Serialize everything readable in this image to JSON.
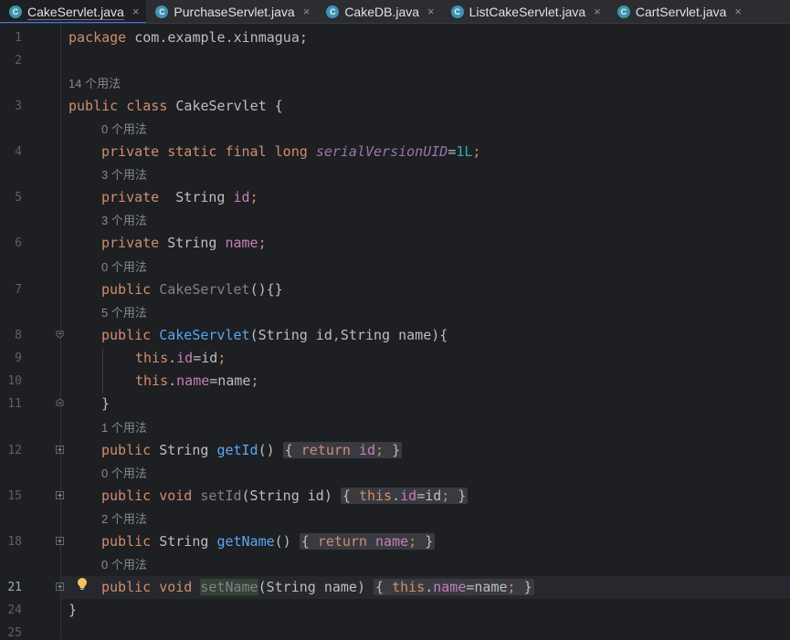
{
  "tabs": [
    {
      "label": "CakeServlet.java",
      "icon": "C",
      "active": true
    },
    {
      "label": "PurchaseServlet.java",
      "icon": "C",
      "active": false
    },
    {
      "label": "CakeDB.java",
      "icon": "C",
      "active": false
    },
    {
      "label": "ListCakeServlet.java",
      "icon": "C",
      "active": false
    },
    {
      "label": "CartServlet.java",
      "icon": "C",
      "active": false
    }
  ],
  "close_glyph": "×",
  "line_numbers": [
    "1",
    "2",
    "3",
    "4",
    "5",
    "6",
    "7",
    "8",
    "9",
    "10",
    "11",
    "12",
    "15",
    "18",
    "21",
    "24",
    "25"
  ],
  "current_line": "21",
  "hints": {
    "class_usages": "14 个用法",
    "serial_usages": "0 个用法",
    "id_usages": "3 个用法",
    "name_usages": "3 个用法",
    "ctor0_usages": "0 个用法",
    "ctor2_usages": "5 个用法",
    "getid_usages": "1 个用法",
    "setid_usages": "0 个用法",
    "getname_usages": "2 个用法",
    "setname_usages": "0 个用法"
  },
  "code": {
    "l1_kw": "package",
    "l1_rest": " com.example.xinmagua;",
    "l3_kw": "public class",
    "l3_rest": " CakeServlet {",
    "l4_kw": "private static final long",
    "l4_field": "serialVersionUID",
    "l4_eq": "=",
    "l4_num": "1L",
    "l4_semi": ";",
    "l5_kw": "private",
    "l5_type": "  String ",
    "l5_field": "id",
    "l5_semi": ";",
    "l6_kw": "private",
    "l6_type": " String ",
    "l6_field": "name",
    "l6_semi": ";",
    "l7_kw": "public",
    "l7_name": "CakeServlet",
    "l7_rest": "(){}",
    "l8_kw": "public",
    "l8_name": "CakeServlet",
    "l8_p1": "(String id",
    "l8_comma": ",",
    "l8_p2": "String name){",
    "l9_this": "this",
    "l9_dot": ".",
    "l9_field": "id",
    "l9_rest": "=id",
    "l9_semi": ";",
    "l10_this": "this",
    "l10_dot": ".",
    "l10_field": "name",
    "l10_rest": "=name",
    "l10_semi": ";",
    "l11": "}",
    "l12_kw": "public",
    "l12_type": " String ",
    "l12_name": "getId",
    "l12_paren": "()",
    "l12_open": "{",
    "l12_ret": "return",
    "l12_field": "id",
    "l12_semi": ";",
    "l12_close": "}",
    "l15_kw": "public void",
    "l15_name": "setId",
    "l15_params": "(String id)",
    "l15_open": "{",
    "l15_this": "this",
    "l15_field": "id",
    "l15_rest": "=id",
    "l15_semi": ";",
    "l15_close": "}",
    "l18_kw": "public",
    "l18_type": " String ",
    "l18_name": "getName",
    "l18_paren": "()",
    "l18_open": "{",
    "l18_ret": "return",
    "l18_field": "name",
    "l18_semi": ";",
    "l18_close": "}",
    "l21_kw": "public void",
    "l21_name": "setName",
    "l21_params": "(String name)",
    "l21_open": "{",
    "l21_this": "this",
    "l21_field": "name",
    "l21_rest": "=name",
    "l21_semi": ";",
    "l21_close": "}",
    "l24": "}"
  },
  "colors": {
    "keyword": "#cf8e6d",
    "field": "#c77dbb",
    "number": "#2aacb8",
    "method_decl": "#56a8f5",
    "text": "#bcbec4",
    "background": "#1e1f22",
    "accent": "#3574f0"
  },
  "icons": {
    "file": "java-class-icon",
    "fold": "fold-toggle-icon",
    "bulb": "intention-bulb-icon"
  }
}
